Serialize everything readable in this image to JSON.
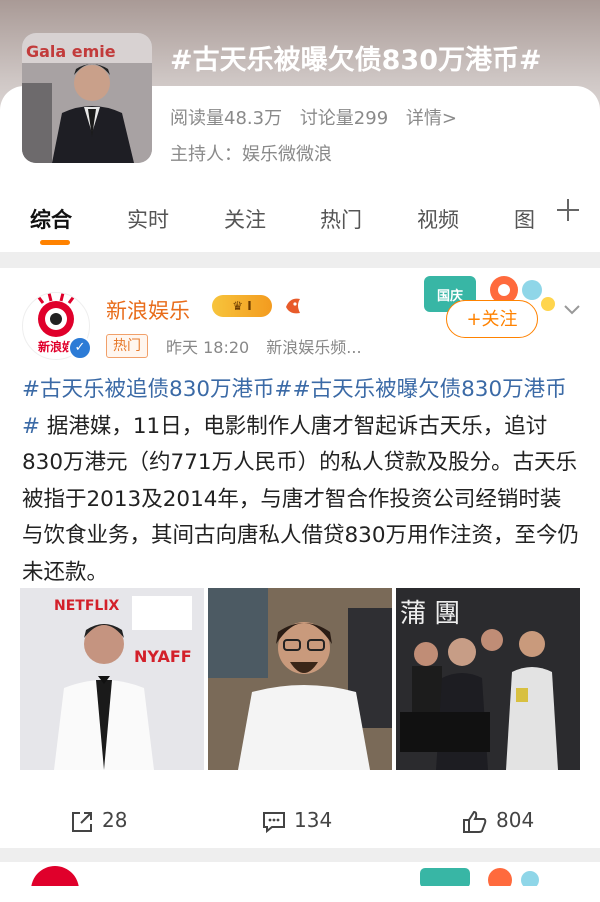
{
  "topic": {
    "title": "#古天乐被曝欠债830万港币#",
    "cover_text": "Gala  emie",
    "read_count": "阅读量48.3万",
    "discussion_count": "讨论量299",
    "details_link": "详情>",
    "host": "主持人：娱乐微微浪"
  },
  "tabs": [
    {
      "label": "综合"
    },
    {
      "label": "实时"
    },
    {
      "label": "关注"
    },
    {
      "label": "热门"
    },
    {
      "label": "视频"
    },
    {
      "label": "图"
    }
  ],
  "post": {
    "author": "新浪娱乐",
    "avatar_label": "新浪娱",
    "level_badge": "I",
    "tag": "热门",
    "time": "昨天 18:20",
    "source": "新浪娱乐频...",
    "follow_label": "+关注",
    "deco_label": "国庆",
    "hashtag1": "#古天乐被追债830万港币#",
    "hashtag2": "#古天乐被曝欠债830万港币#",
    "body": " 据港媒，11日，电影制作人唐才智起诉古天乐，追讨830万港元（约771万人民币）的私人贷款及股分。古天乐被指于2013及2014年，与唐才智合作投资公司经销时装与饮食业务，其间古向唐私人借贷830万用作注资，至今仍未还款。",
    "photo1_text": "NETFLIX",
    "photo1_text2": "NYAFF",
    "photo3_text": "蒲 團",
    "repost_count": "28",
    "comment_count": "134",
    "like_count": "804"
  },
  "colors": {
    "accent": "#ff8200",
    "hashtag": "#3b6aa6",
    "author": "#e86c1a"
  }
}
